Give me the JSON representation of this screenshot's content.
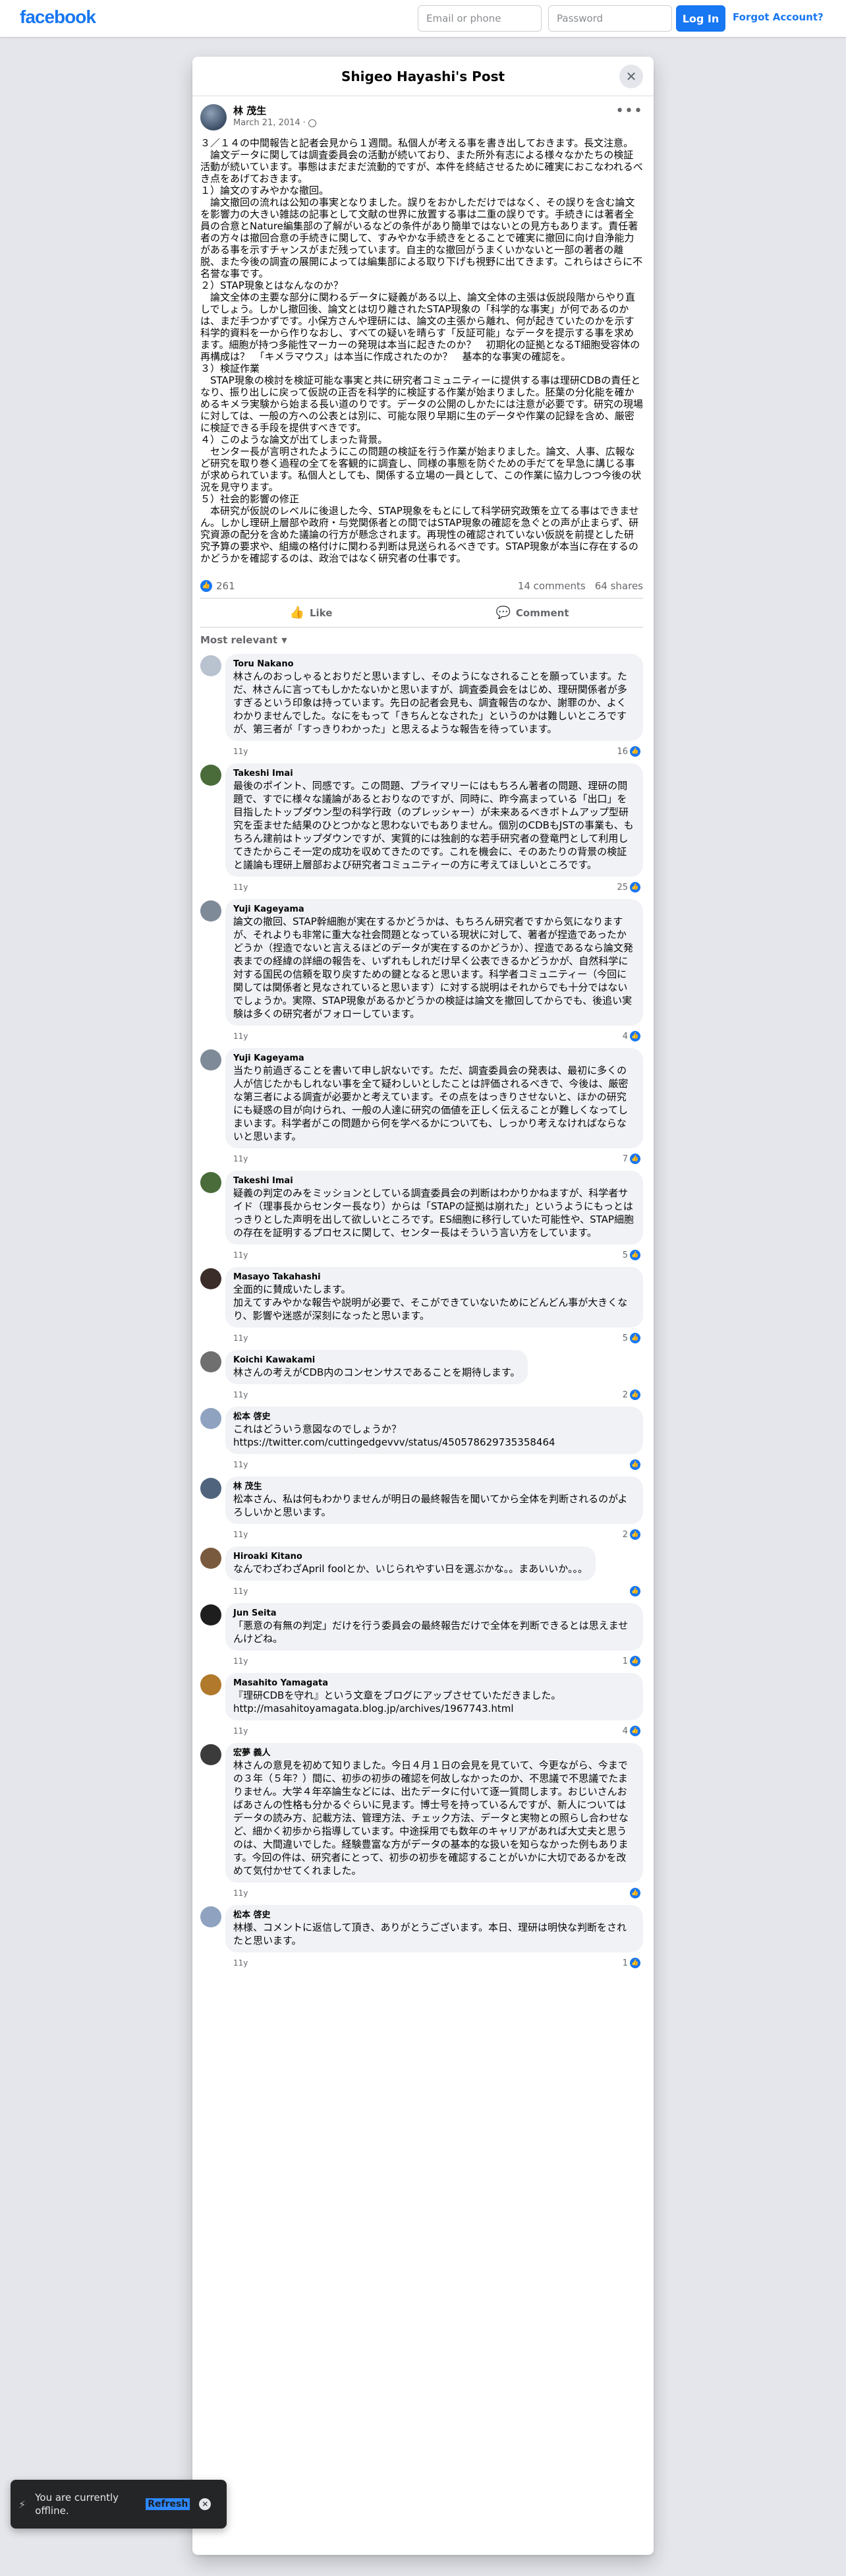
{
  "topbar": {
    "logo": "facebook",
    "email_placeholder": "Email or phone",
    "password_placeholder": "Password",
    "login_label": "Log In",
    "forgot_label": "Forgot Account?"
  },
  "modal": {
    "title": "Shigeo Hayashi's Post"
  },
  "post": {
    "author": "林 茂生",
    "date": "March 21, 2014",
    "body": [
      "３／１４の中間報告と記者会見から１週間。私個人が考える事を書き出しておきます。長文注意。",
      "　論文データに関しては調査委員会の活動が続いており、また所外有志による様々なかたちの検証活動が続いています。事態はまだまだ流動的ですが、本件を終結させるために確実におこなわれるべき点をあげておきます。",
      "１）論文のすみやかな撤回。",
      "　論文撤回の流れは公知の事実となりました。誤りをおかしただけではなく、その誤りを含む論文を影響力の大きい雑誌の記事として文献の世界に放置する事は二重の誤りです。手続きには著者全員の合意とNature編集部の了解がいるなどの条件があり簡単ではないとの見方もあります。責任著者の方々は撤回合意の手続きに関して、すみやかな手続きをとることで確実に撤回に向け自浄能力がある事を示すチャンスがまだ残っています。自主的な撤回がうまくいかないと一部の著者の離脱、また今後の調査の展開によっては編集部による取り下げも視野に出てきます。これらはさらに不名誉な事です。",
      "２）STAP現象とはなんなのか？",
      "　論文全体の主要な部分に関わるデータに疑義がある以上、論文全体の主張は仮説段階からやり直しでしょう。しかし撤回後、論文とは切り離されたSTAP現象の「科学的な事実」が何であるのかは、まだ手つかずです。小保方さんや理研には、論文の主張から離れ、何が起きていたのかを示す科学的資料を一から作りなおし、すべての疑いを晴らす「反証可能」なデータを提示する事を求めます。細胞が持つ多能性マーカーの発現は本当に起きたのか？　初期化の証拠となるT細胞受容体の再構成は？　「キメラマウス」は本当に作成されたのか？　基本的な事実の確認を。",
      "３）検証作業",
      "　STAP現象の検討を検証可能な事実と共に研究者コミュニティーに提供する事は理研CDBの責任となり、振り出しに戻って仮説の正否を科学的に検証する作業が始まりました。胚葉の分化能を確かめるキメラ実験から始まる長い道のりです。データの公開のしかたには注意が必要です。研究の現場に対しては、一般の方への公表とは別に、可能な限り早期に生のデータや作業の記録を含め、厳密に検証できる手段を提供すべきです。",
      "４）このような論文が出てしまった背景。",
      "　センター長が言明されたようにこの問題の検証を行う作業が始まりました。論文、人事、広報など研究を取り巻く過程の全てを客観的に調査し、同様の事態を防ぐための手だてを早急に講じる事が求められています。私個人としても、関係する立場の一員として、この作業に協力しつつ今後の状況を見守ります。",
      "５）社会的影響の修正",
      "　本研究が仮説のレベルに後退した今、STAP現象をもとにして科学研究政策を立てる事はできません。しかし理研上層部や政府・与党関係者との間ではSTAP現象の確認を急ぐとの声が止まらず、研究資源の配分を含めた議論の行方が懸念されます。再現性の確認されていない仮説を前提とした研究予算の要求や、組織の格付けに関わる判断は見送られるべきです。STAP現象が本当に存在するのかどうかを確認するのは、政治ではなく研究者の仕事です。"
    ],
    "like_count": "261",
    "comments_count": "14 comments",
    "shares_count": "64 shares",
    "like_label": "Like",
    "comment_label": "Comment",
    "sort_label": "Most relevant"
  },
  "comments": [
    {
      "name": "Toru Nakano",
      "text": "林さんのおっしゃるとおりだと思いますし、そのようになされることを願っています。ただ、林さんに言ってもしかたないかと思いますが、調査委員会をはじめ、理研関係者が多すぎるという印象は持っています。先日の記者会見も、調査報告のなか、謝罪のか、よくわかりませんでした。なにをもって「きちんとなされた」というのかは難しいところですが、第三者が「すっきりわかった」と思えるような報告を待っています。",
      "time": "11y",
      "reactions": "16",
      "color": "#b9c2cf"
    },
    {
      "name": "Takeshi Imai",
      "text": "最後のポイント、同感です。この問題、プライマリーにはもちろん著者の問題、理研の問題で、すでに様々な議論があるとおりなのですが、同時に、昨今高まっている「出口」を目指したトップダウン型の科学行政（のプレッシャー）が未来あるべきボトムアップ型研究を歪ませた結果のひとつかなと思わないでもありません。個別のCDBもJSTの事業も、もちろん建前はトップダウンですが、実質的には独創的な若手研究者の登竜門として利用してきたからこそ一定の成功を収めてきたのです。これを機会に、そのあたりの背景の検証と議論も理研上層部および研究者コミュニティーの方に考えてほしいところです。",
      "time": "11y",
      "reactions": "25",
      "color": "#4a6b3a"
    },
    {
      "name": "Yuji Kageyama",
      "text": "論文の撤回、STAP幹細胞が実在するかどうかは、もちろん研究者ですから気になりますが、それよりも非常に重大な社会問題となっている現状に対して、著者が捏造であったかどうか（捏造でないと言えるほどのデータが実在するのかどうか）、捏造であるなら論文発表までの経緯の詳細の報告を、いずれもしれだけ早く公表できるかどうかが、自然科学に対する国民の信頼を取り戻すための鍵となると思います。科学者コミュニティー（今回に関しては関係者と見なされていると思います）に対する説明はそれからでも十分ではないでしょうか。実際、STAP現象があるかどうかの検証は論文を撤回してからでも、後追い実験は多くの研究者がフォローしています。",
      "time": "11y",
      "reactions": "4",
      "color": "#7e8a98"
    },
    {
      "name": "Yuji Kageyama",
      "text": "当たり前過ぎることを書いて申し訳ないです。ただ、調査委員会の発表は、最初に多くの人が信じたかもしれない事を全て疑わしいとしたことは評価されるべきで、今後は、厳密な第三者による調査が必要かと考えています。その点をはっきりさせないと、ほかの研究にも疑惑の目が向けられ、一般の人達に研究の価値を正しく伝えることが難しくなってしまいます。科学者がこの問題から何を学べるかについても、しっかり考えなければならないと思います。",
      "time": "11y",
      "reactions": "7",
      "color": "#7e8a98"
    },
    {
      "name": "Takeshi Imai",
      "text": "疑義の判定のみをミッションとしている調査委員会の判断はわかりかねますが、科学者サイド（理事長からセンター長なり）からは「STAPの証拠は崩れた」というようにもっとはっきりとした声明を出して欲しいところです。ES細胞に移行していた可能性や、STAP細胞の存在を証明するプロセスに関して、センター長はそういう言い方をしています。",
      "time": "11y",
      "reactions": "5",
      "color": "#4a6b3a"
    },
    {
      "name": "Masayo Takahashi",
      "text": "全面的に賛成いたします。\n加えてすみやかな報告や説明が必要で、そこができていないためにどんどん事が大きくなり、影響や迷惑が深刻になったと思います。",
      "time": "11y",
      "reactions": "5",
      "color": "#3a2d2a"
    },
    {
      "name": "Koichi Kawakami",
      "text": "林さんの考えがCDB内のコンセンサスであることを期待します。",
      "time": "11y",
      "reactions": "2",
      "color": "#6f6f6f"
    },
    {
      "name": "松本 啓史",
      "text": "これはどういう意図なのでしょうか？\nhttps://twitter.com/cuttingedgevvv/status/450578629735358464",
      "time": "11y",
      "reactions": "",
      "color": "#8fa3c1"
    },
    {
      "name": "林 茂生",
      "text": "松本さん、私は何もわかりませんが明日の最終報告を聞いてから全体を判断されるのがよろしいかと思います。",
      "time": "11y",
      "reactions": "2",
      "color": "#50647d"
    },
    {
      "name": "Hiroaki Kitano",
      "text": "なんでわざわざApril foolとか、いじられやすい日を選ぶかな。。まあいいか。。。",
      "time": "11y",
      "reactions": "",
      "color": "#7a5a3e"
    },
    {
      "name": "Jun Seita",
      "text": "「悪意の有無の判定」だけを行う委員会の最終報告だけで全体を判断できるとは思えませんけどね。",
      "time": "11y",
      "reactions": "1",
      "color": "#1e1e1e"
    },
    {
      "name": "Masahito Yamagata",
      "text": "『理研CDBを守れ』という文章をブログにアップさせていただきました。\nhttp://masahitoyamagata.blog.jp/archives/1967743.html",
      "time": "11y",
      "reactions": "4",
      "color": "#b0792b"
    },
    {
      "name": "宏夢 義人",
      "text": "林さんの意見を初めて知りました。今日４月１日の会見を見ていて、今更ながら、今までの３年（５年？）間に、初歩の初歩の確認を何故しなかったのか、不思議で不思議でたまりません。大学４年卒論生などには、出たデータに付いて逐一質問します。おじいさんおばあさんの性格も分かるぐらいに見ます。博士号を持っているんですが、新人についてはデータの読み方、記載方法、管理方法、チェック方法、データと実物との照らし合わせなど、細かく初歩から指導しています。中途採用でも数年のキャリアがあれば大丈夫と思うのは、大間違いでした。経験豊富な方がデータの基本的な扱いを知らなかった例もあります。今回の件は、研究者にとって、初歩の初歩を確認することがいかに大切であるかを改めて気付かせてくれました。",
      "time": "11y",
      "reactions": "",
      "color": "#3b3b3b"
    },
    {
      "name": "松本 啓史",
      "text": "林様、コメントに返信して頂き、ありがとうございます。本日、理研は明快な判断をされたと思います。",
      "time": "11y",
      "reactions": "1",
      "color": "#8fa3c1"
    }
  ],
  "toast": {
    "message": "You are currently offline.",
    "refresh_label": "Refresh"
  }
}
